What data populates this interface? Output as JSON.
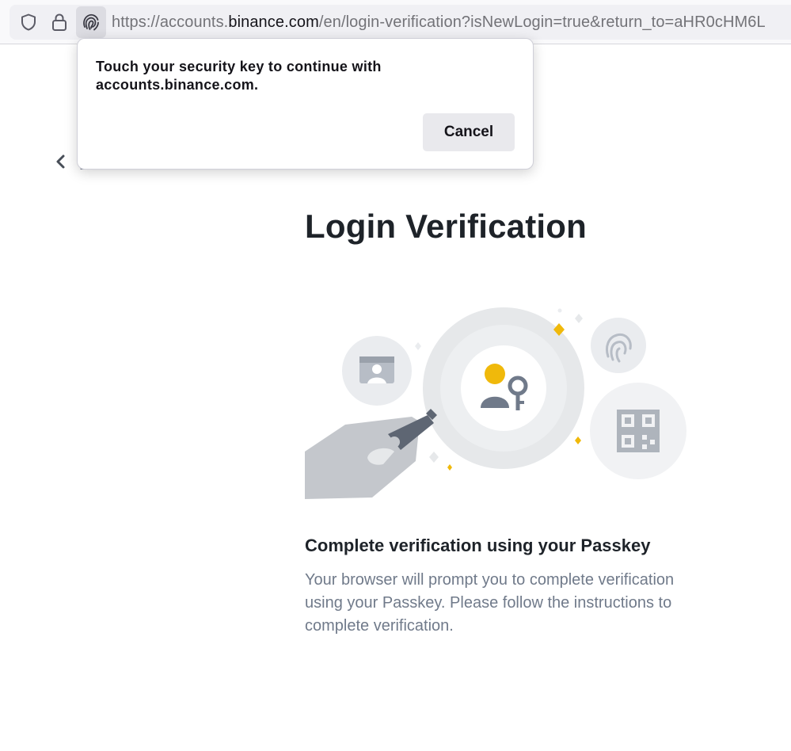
{
  "browser": {
    "url_prefix": "https://accounts.",
    "url_domain": "binance.com",
    "url_suffix": "/en/login-verification?isNewLogin=true&return_to=aHR0cHM6L",
    "icons": [
      "shield-icon",
      "lock-icon",
      "fingerprint-icon"
    ]
  },
  "popup": {
    "message": "Touch your security key to continue with accounts.binance.com.",
    "cancel_label": "Cancel"
  },
  "page": {
    "back_label": "Back",
    "title": "Login Verification",
    "subtitle": "Complete verification using your Passkey",
    "description": "Your browser will prompt you to complete verification using your Passkey. Please follow the instructions to complete verification."
  },
  "colors": {
    "accent_yellow": "#fcd535",
    "heading": "#1e2329",
    "muted_text": "#707a8a",
    "illustration_gray": "#c4c7cc"
  }
}
